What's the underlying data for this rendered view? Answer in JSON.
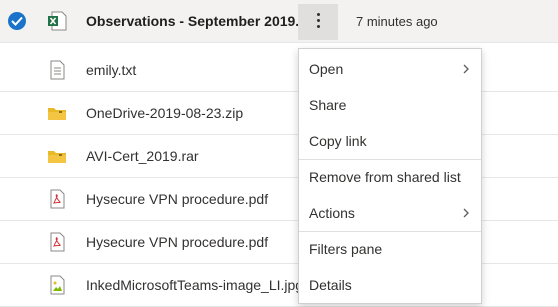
{
  "files": [
    {
      "name": "Observations - September 2019....",
      "modified": "7 minutes ago",
      "icon": "excel-file-icon",
      "selected": true
    },
    {
      "name": "emily.txt",
      "icon": "text-file-icon"
    },
    {
      "name": "OneDrive-2019-08-23.zip",
      "icon": "folder-icon"
    },
    {
      "name": "AVI-Cert_2019.rar",
      "icon": "folder-icon"
    },
    {
      "name": "Hysecure VPN procedure.pdf",
      "icon": "pdf-file-icon"
    },
    {
      "name": "Hysecure VPN procedure.pdf",
      "icon": "pdf-file-icon"
    },
    {
      "name": "InkedMicrosoftTeams-image_LI.jpg",
      "icon": "image-file-icon"
    }
  ],
  "context_menu": {
    "items": [
      {
        "label": "Open",
        "submenu": true
      },
      {
        "label": "Share"
      },
      {
        "label": "Copy link"
      },
      {
        "label": "Remove from shared list"
      },
      {
        "label": "Actions",
        "submenu": true
      },
      {
        "label": "Filters pane"
      },
      {
        "label": "Details"
      }
    ]
  },
  "colors": {
    "accent": "#1a73c9",
    "excel": "#217346",
    "folder": "#e8b929",
    "pdf": "#d13438",
    "selected_row": "#f3f2f1"
  }
}
